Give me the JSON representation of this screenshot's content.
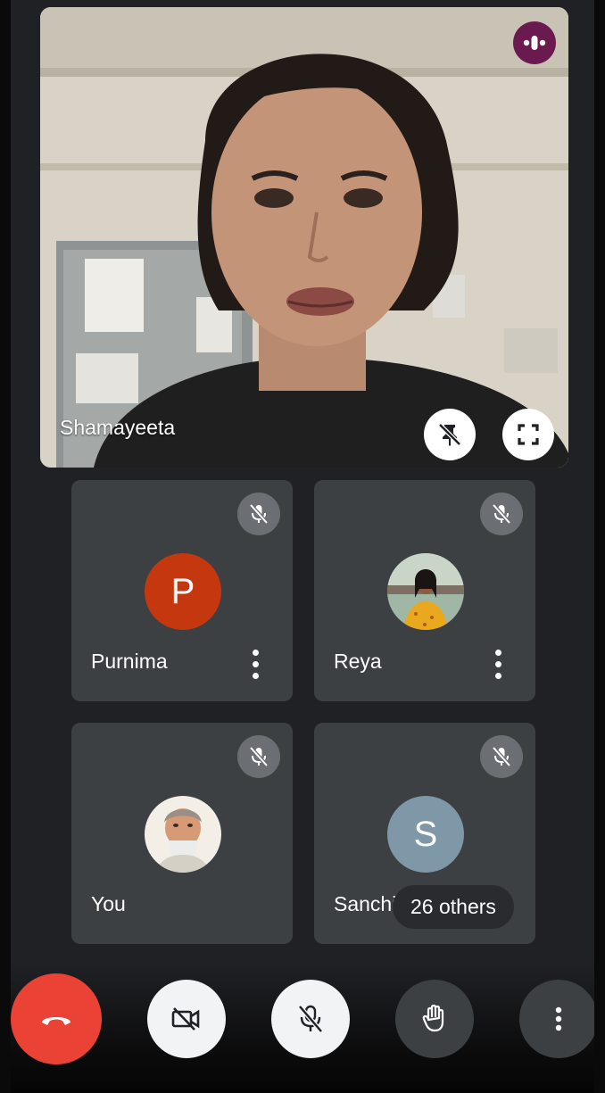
{
  "main_video": {
    "participant_name": "Shamayeeta",
    "speaking_indicator_color": "#6b1a4f",
    "controls": [
      "unpin-icon",
      "fullscreen-icon"
    ]
  },
  "participants": [
    {
      "name": "Purnima",
      "avatar_type": "initial",
      "initial": "P",
      "avatar_color": "#c5380f",
      "muted": true,
      "has_more_menu": true
    },
    {
      "name": "Reya",
      "avatar_type": "photo",
      "muted": true,
      "has_more_menu": true
    },
    {
      "name": "You",
      "avatar_type": "photo",
      "muted": true,
      "has_more_menu": false
    },
    {
      "name": "Sanchi",
      "avatar_type": "initial",
      "initial": "S",
      "avatar_color": "#7f98a8",
      "muted": true,
      "has_more_menu": false
    }
  ],
  "others_chip": {
    "label": "26 others"
  },
  "controls": {
    "end_call_color": "#ea4335",
    "camera_state": "off",
    "mic_state": "muted",
    "icons": [
      "end-call-icon",
      "camera-off-icon",
      "mic-off-icon",
      "raise-hand-icon",
      "more-options-icon"
    ]
  },
  "colors": {
    "background": "#202124",
    "tile": "#3c4043",
    "mute_badge": "#6b6f73"
  }
}
